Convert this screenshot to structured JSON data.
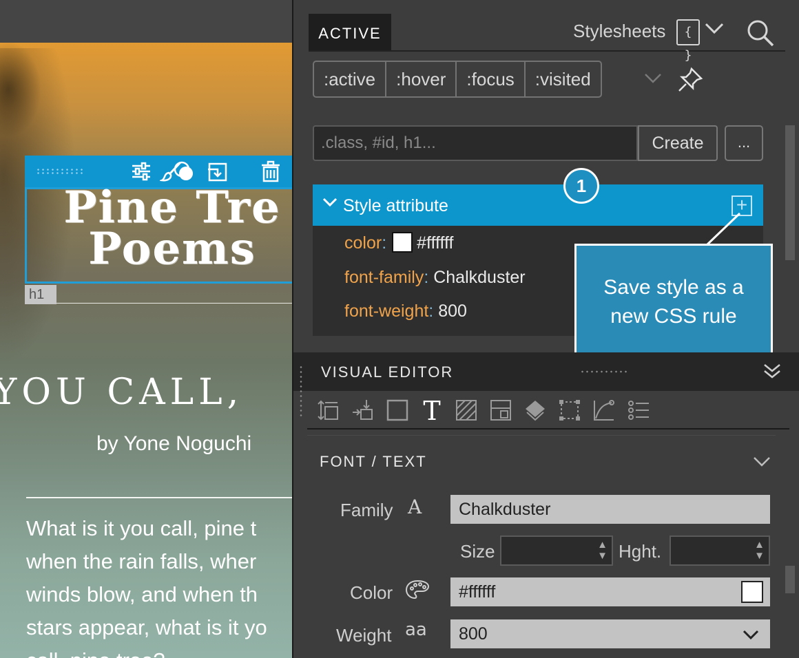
{
  "canvas": {
    "heading_line1": "Pine Tre",
    "heading_line2": "Poems",
    "element_tag": "h1",
    "poem_title": "YOU CALL,",
    "poem_author": "by Yone Noguchi",
    "poem_lines": [
      "What is it you call, pine t",
      "when the rain falls, wher",
      "winds blow, and when th",
      "stars appear, what is it yo",
      "call, pine tree?"
    ]
  },
  "panel": {
    "tab_active": "ACTIVE",
    "stylesheets_label": "Stylesheets",
    "stylesheets_icon_text": "{ }",
    "states": [
      ":active",
      ":hover",
      ":focus",
      ":visited"
    ],
    "selector_placeholder": ".class, #id, h1...",
    "create_label": "Create",
    "more_label": "...",
    "rule_header": "Style attribute",
    "properties": [
      {
        "name": "color",
        "value": "#ffffff"
      },
      {
        "name": "font-family",
        "value": "Chalkduster"
      },
      {
        "name": "font-weight",
        "value": "800"
      }
    ],
    "tooltip": {
      "badge": "1",
      "text_line1": "Save style as a",
      "text_line2": "new CSS rule"
    },
    "visual_editor_title": "VISUAL EDITOR",
    "section_title": "FONT / TEXT",
    "font": {
      "family_label": "Family",
      "family_glyph": "A",
      "family_value": "Chalkduster",
      "size_label": "Size",
      "height_label": "Hght.",
      "color_label": "Color",
      "color_value": "#ffffff",
      "weight_label": "Weight",
      "weight_glyph": "aa",
      "weight_value": "800"
    }
  },
  "colors": {
    "accent": "#0d96cc",
    "property_name": "#f0a34a",
    "tooltip_bg": "#2a8bb7"
  }
}
